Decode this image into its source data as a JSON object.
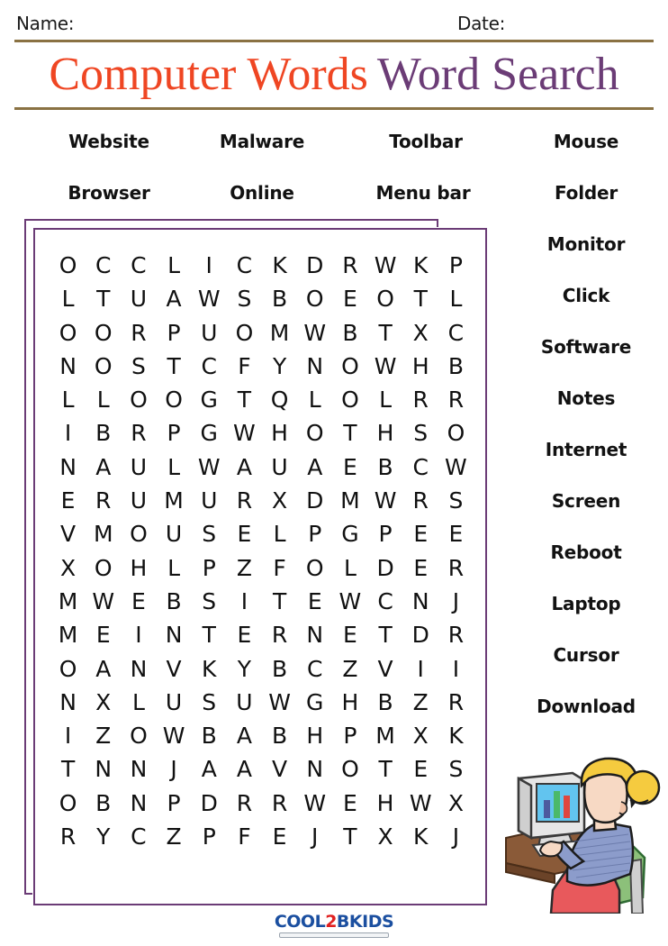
{
  "header": {
    "name_label": "Name:",
    "date_label": "Date:",
    "rule_color": "#8a7243"
  },
  "title": {
    "topic": "Computer Words",
    "kind": "Word Search",
    "topic_color": "#ef4623",
    "kind_color": "#6b3c76"
  },
  "wordbank": {
    "top_rows": [
      [
        "Website",
        "Malware",
        "Toolbar"
      ],
      [
        "Browser",
        "Online",
        "Menu bar"
      ]
    ],
    "right_column": [
      "Mouse",
      "Folder",
      "Monitor",
      "Click",
      "Software",
      "Notes",
      "Internet",
      "Screen",
      "Reboot",
      "Laptop",
      "Cursor",
      "Download"
    ],
    "all_words": [
      "Website",
      "Malware",
      "Toolbar",
      "Mouse",
      "Browser",
      "Online",
      "Menu bar",
      "Folder",
      "Monitor",
      "Click",
      "Software",
      "Notes",
      "Internet",
      "Screen",
      "Reboot",
      "Laptop",
      "Cursor",
      "Download"
    ]
  },
  "puzzle": {
    "rows": 18,
    "cols": 12,
    "frame_color": "#6b3c76",
    "grid": [
      [
        "O",
        "C",
        "C",
        "L",
        "I",
        "C",
        "K",
        "D",
        "R",
        "W",
        "K",
        "P"
      ],
      [
        "L",
        "T",
        "U",
        "A",
        "W",
        "S",
        "B",
        "O",
        "E",
        "O",
        "T",
        "L"
      ],
      [
        "O",
        "O",
        "R",
        "P",
        "U",
        "O",
        "M",
        "W",
        "B",
        "T",
        "X",
        "C"
      ],
      [
        "N",
        "O",
        "S",
        "T",
        "C",
        "F",
        "Y",
        "N",
        "O",
        "W",
        "H",
        "B"
      ],
      [
        "L",
        "L",
        "O",
        "O",
        "G",
        "T",
        "Q",
        "L",
        "O",
        "L",
        "R",
        "R"
      ],
      [
        "I",
        "B",
        "R",
        "P",
        "G",
        "W",
        "H",
        "O",
        "T",
        "H",
        "S",
        "O"
      ],
      [
        "N",
        "A",
        "U",
        "L",
        "W",
        "A",
        "U",
        "A",
        "E",
        "B",
        "C",
        "W"
      ],
      [
        "E",
        "R",
        "U",
        "M",
        "U",
        "R",
        "X",
        "D",
        "M",
        "W",
        "R",
        "S"
      ],
      [
        "V",
        "M",
        "O",
        "U",
        "S",
        "E",
        "L",
        "P",
        "G",
        "P",
        "E",
        "E"
      ],
      [
        "X",
        "O",
        "H",
        "L",
        "P",
        "Z",
        "F",
        "O",
        "L",
        "D",
        "E",
        "R"
      ],
      [
        "M",
        "W",
        "E",
        "B",
        "S",
        "I",
        "T",
        "E",
        "W",
        "C",
        "N",
        "J"
      ],
      [
        "M",
        "E",
        "I",
        "N",
        "T",
        "E",
        "R",
        "N",
        "E",
        "T",
        "D",
        "R"
      ],
      [
        "O",
        "A",
        "N",
        "V",
        "K",
        "Y",
        "B",
        "C",
        "Z",
        "V",
        "I",
        "I"
      ],
      [
        "N",
        "X",
        "L",
        "U",
        "S",
        "U",
        "W",
        "G",
        "H",
        "B",
        "Z",
        "R"
      ],
      [
        "I",
        "Z",
        "O",
        "W",
        "B",
        "A",
        "B",
        "H",
        "P",
        "M",
        "X",
        "K"
      ],
      [
        "T",
        "N",
        "N",
        "J",
        "A",
        "A",
        "V",
        "N",
        "O",
        "T",
        "E",
        "S"
      ],
      [
        "O",
        "B",
        "N",
        "P",
        "D",
        "R",
        "R",
        "W",
        "E",
        "H",
        "W",
        "X"
      ],
      [
        "R",
        "Y",
        "C",
        "Z",
        "P",
        "F",
        "E",
        "J",
        "T",
        "X",
        "K",
        "J"
      ]
    ]
  },
  "illustration": {
    "name": "girl-at-computer-illustration",
    "colors": {
      "hair": "#f5cb3f",
      "skin": "#f7d9c4",
      "sweater": "#8c9ccb",
      "pants": "#e8595c",
      "chair": "#8cc07a",
      "desk": "#8a5a38",
      "monitor": "#e2e2e2",
      "screen": "#62c4ef"
    }
  },
  "footer": {
    "logo_part1": "COOL",
    "logo_digit": "2",
    "logo_part2": "BKIDS",
    "logo_color": "#1b4fa0",
    "logo_digit_color": "#e02020"
  }
}
